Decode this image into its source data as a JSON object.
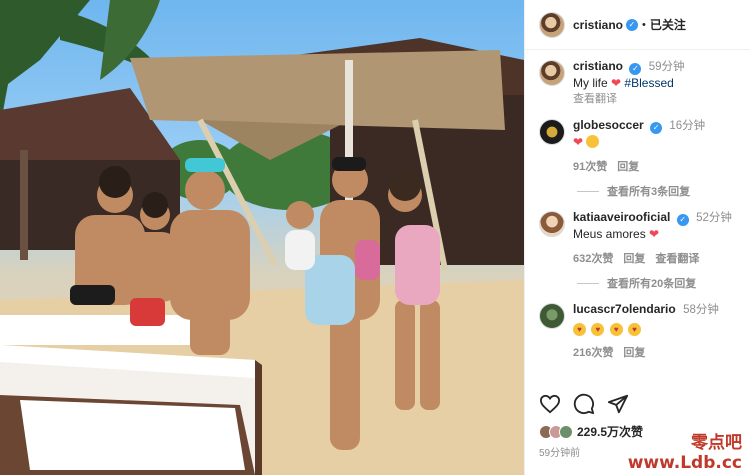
{
  "post": {
    "username": "cristiano",
    "follow_state": "已关注",
    "caption": {
      "username": "cristiano",
      "time": "59分钟",
      "text": "My life",
      "hashtag": "#Blessed",
      "translate": "查看翻译"
    },
    "comments": [
      {
        "username": "globesoccer",
        "time": "16分钟",
        "likes": "91次赞",
        "reply": "回复",
        "view_replies": "查看所有3条回复"
      },
      {
        "username": "katiaaveirooficial",
        "time": "52分钟",
        "text": "Meus amores",
        "likes": "632次赞",
        "reply": "回复",
        "translate": "查看翻译",
        "view_replies": "查看所有20条回复"
      },
      {
        "username": "lucascr7olendario",
        "time": "58分钟",
        "likes": "216次赞",
        "reply": "回复"
      }
    ],
    "like_count": "229.5万次赞",
    "posted_ago": "59分钟前"
  },
  "watermark": {
    "line1": "零点吧",
    "line2": "www.Ldb.cc"
  },
  "icons": [
    "verified-badge-icon",
    "heart-icon",
    "comment-icon",
    "share-icon"
  ],
  "colors": {
    "verified": "#3897f0",
    "heart": "#ed4956",
    "hashtag": "#00376b",
    "watermark": "#c0392b"
  }
}
